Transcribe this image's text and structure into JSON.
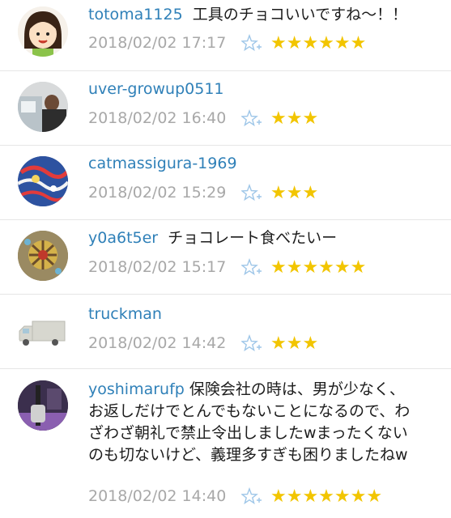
{
  "comments": [
    {
      "user": "totoma1125",
      "text": "工具のチョコいいですね〜！！",
      "time": "2018/02/02 17:17",
      "stars": "★★★★★★"
    },
    {
      "user": "uver-growup0511",
      "text": "",
      "time": "2018/02/02 16:40",
      "stars": "★★★"
    },
    {
      "user": "catmassigura-1969",
      "text": "",
      "time": "2018/02/02 15:29",
      "stars": "★★★"
    },
    {
      "user": "y0a6t5er",
      "text": "チョコレート食べたいー",
      "time": "2018/02/02 15:17",
      "stars": "★★★★★★"
    },
    {
      "user": "truckman",
      "text": "",
      "time": "2018/02/02 14:42",
      "stars": "★★★"
    },
    {
      "user": "yoshimarufp",
      "text": "保険会社の時は、男が少なく、お返しだけでとんでもないことになるので、わざわざ朝礼で禁止令出しましたwまったくないのも切ないけど、義理多すぎも困りましたねw",
      "time": "2018/02/02 14:40",
      "stars": "★★★★★★★"
    }
  ],
  "colors": {
    "username": "#2f80b8",
    "star": "#f2c500",
    "timestamp": "#a8a8a8"
  },
  "icons": {
    "add_star": "star-plus-icon"
  }
}
